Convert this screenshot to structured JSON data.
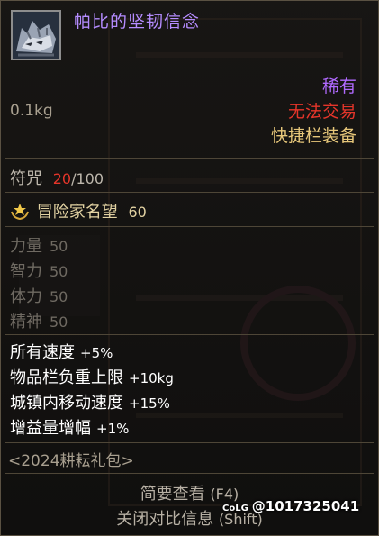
{
  "item": {
    "name": "帕比的坚韧信念",
    "icon": "wolf-head-icon",
    "rarity": "稀有",
    "trade": "无法交易",
    "slot": "快捷栏装备",
    "weight": "0.1kg"
  },
  "talisman": {
    "label": "符咒",
    "current": "20",
    "max": "/100"
  },
  "fame": {
    "label": "冒险家名望",
    "value": "60",
    "icon": "laurel-icon"
  },
  "base_stats": [
    {
      "label": "力量",
      "value": "50"
    },
    {
      "label": "智力",
      "value": "50"
    },
    {
      "label": "体力",
      "value": "50"
    },
    {
      "label": "精神",
      "value": "50"
    }
  ],
  "bonuses": [
    {
      "label": "所有速度",
      "value": "+5%"
    },
    {
      "label": "物品栏负重上限",
      "value": "+10kg"
    },
    {
      "label": "城镇内移动速度",
      "value": "+15%"
    },
    {
      "label": "增益量增幅",
      "value": "+1%"
    }
  ],
  "set_name": "<2024耕耘礼包>",
  "footer": {
    "summary_label": "简要查看",
    "summary_key": "(F4)",
    "compare_label": "关闭对比信息",
    "compare_key": "(Shift)"
  },
  "watermark": {
    "brand": "CoLG",
    "text": "@1017325041"
  },
  "colors": {
    "name": "#b58cff",
    "rarity": "#b069ff",
    "untradeable": "#e5352a",
    "slot": "#e7c77a",
    "border": "#5a5142"
  }
}
